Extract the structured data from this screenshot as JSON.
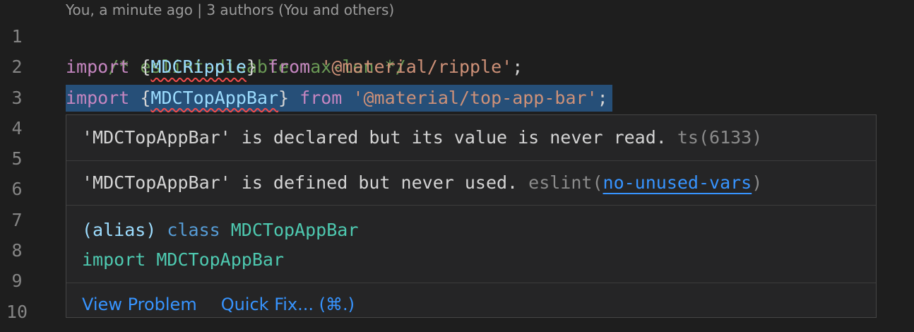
{
  "blame": "You, a minute ago | 3 authors (You and others)",
  "line_numbers": [
    "1",
    "2",
    "3",
    "4",
    "5",
    "6",
    "7",
    "8",
    "9",
    "10"
  ],
  "code": {
    "line1": "/* eslint-disable max-len */",
    "line2": {
      "kw_import": "import",
      "open": " {",
      "ident": "MDCRipple",
      "close": "} ",
      "kw_from": "from",
      "space": " ",
      "string": "'@material/ripple'",
      "semi": ";"
    },
    "line3": {
      "kw_import": "import",
      "open": " {",
      "ident": "MDCTopAppBar",
      "close": "} ",
      "kw_from": "from",
      "space": " ",
      "string": "'@material/top-app-bar'",
      "semi": ";"
    }
  },
  "hover": {
    "problem1": {
      "message": "'MDCTopAppBar' is declared but its value is never read. ",
      "source": "ts(6133)"
    },
    "problem2": {
      "message": "'MDCTopAppBar' is defined but never used. ",
      "source": "eslint(",
      "rule": "no-unused-vars",
      "source_close": ")"
    },
    "signature": {
      "alias": "(alias)",
      "class_kw": "class",
      "class_name": "MDCTopAppBar",
      "import_kw": "import",
      "import_name": "MDCTopAppBar"
    },
    "actions": {
      "view_problem": "View Problem",
      "quick_fix": "Quick Fix... (⌘.)"
    }
  },
  "colors": {
    "background": "#1e1e1e",
    "hover_background": "#252526",
    "selection": "#264f78",
    "link": "#3794ff",
    "error_squiggle": "#f14c4c"
  }
}
